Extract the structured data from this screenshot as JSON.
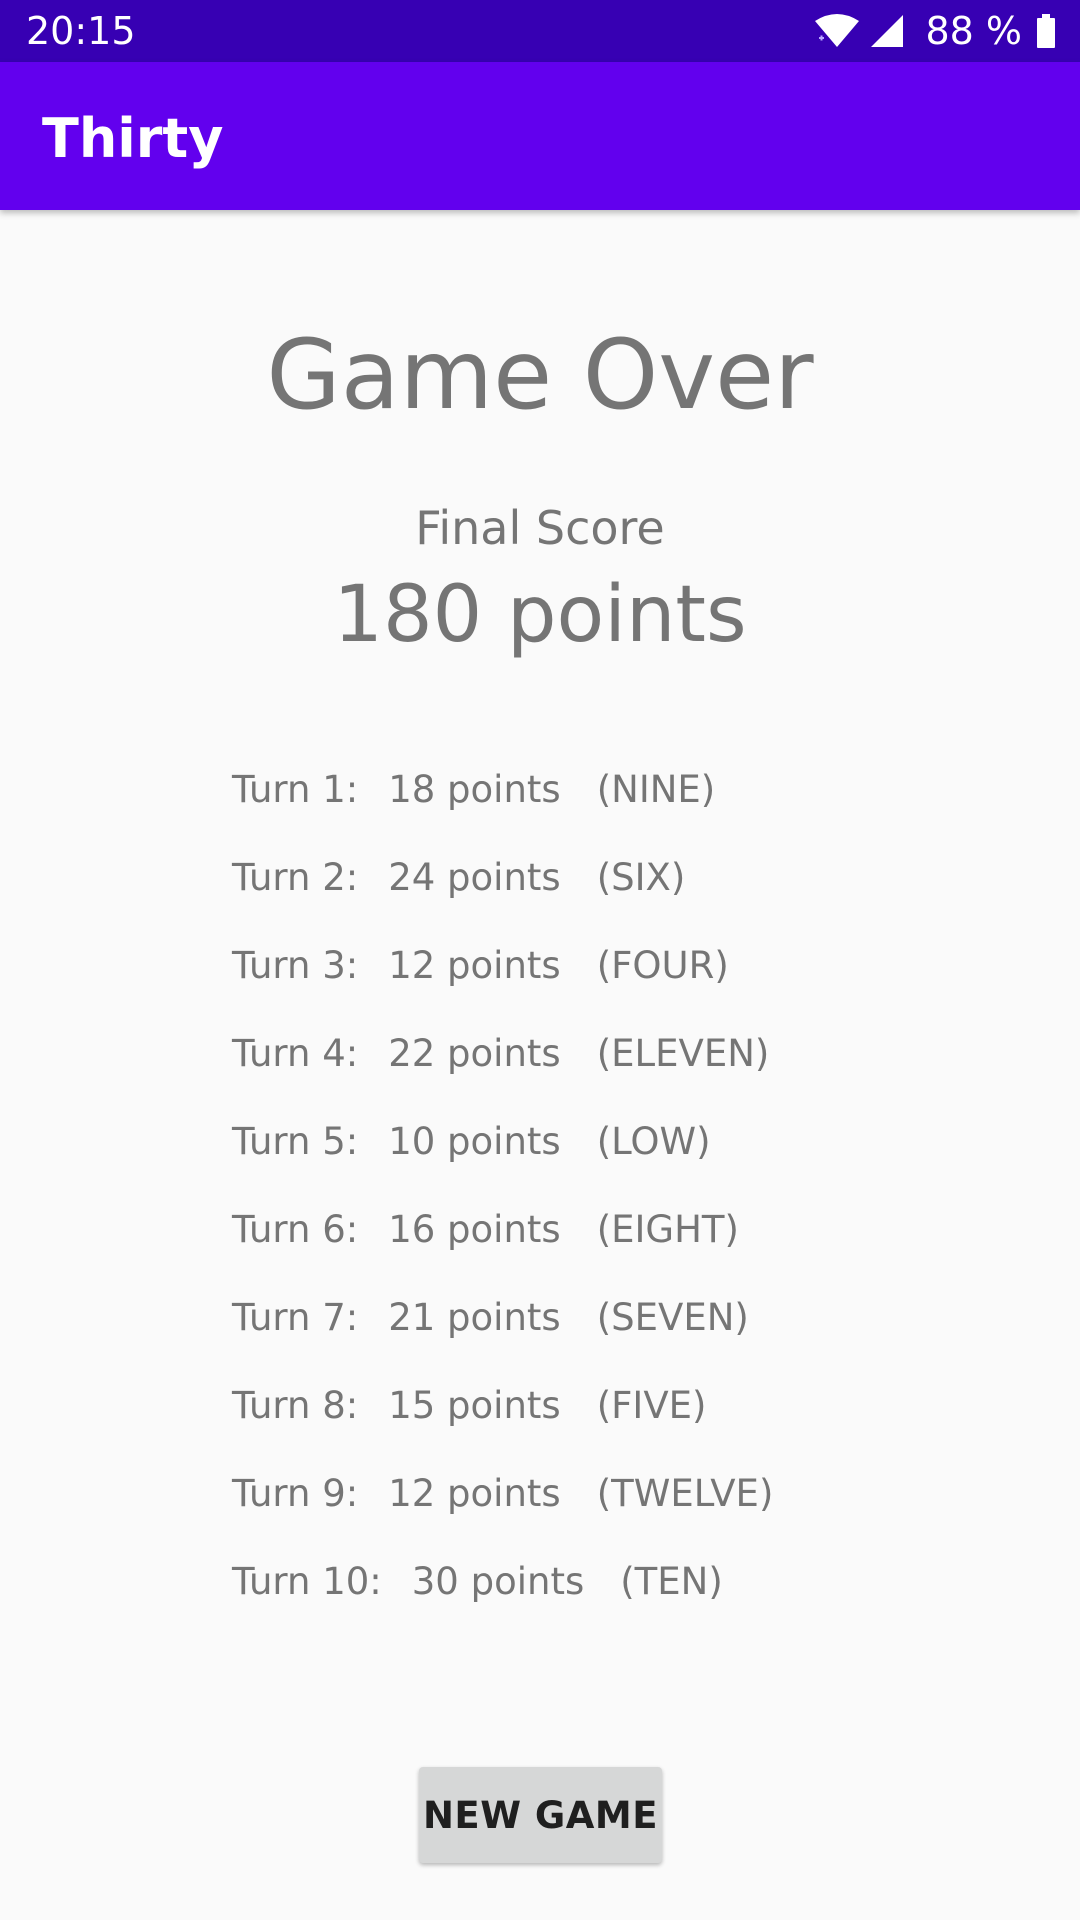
{
  "status_bar": {
    "time": "20:15",
    "battery": "88 %",
    "icons": [
      "wifi-icon",
      "signal-icon",
      "battery-icon"
    ]
  },
  "app_bar": {
    "title": "Thirty"
  },
  "main": {
    "heading": "Game Over",
    "final_score_label": "Final Score",
    "final_score_value": "180 points",
    "turns": [
      {
        "label": "Turn 1:",
        "points": "18 points",
        "choice": "(NINE)"
      },
      {
        "label": "Turn 2:",
        "points": "24 points",
        "choice": "(SIX)"
      },
      {
        "label": "Turn 3:",
        "points": "12 points",
        "choice": "(FOUR)"
      },
      {
        "label": "Turn 4:",
        "points": "22 points",
        "choice": "(ELEVEN)"
      },
      {
        "label": "Turn 5:",
        "points": "10 points",
        "choice": "(LOW)"
      },
      {
        "label": "Turn 6:",
        "points": "16 points",
        "choice": "(EIGHT)"
      },
      {
        "label": "Turn 7:",
        "points": "21 points",
        "choice": "(SEVEN)"
      },
      {
        "label": "Turn 8:",
        "points": "15 points",
        "choice": "(FIVE)"
      },
      {
        "label": "Turn 9:",
        "points": "12 points",
        "choice": "(TWELVE)"
      },
      {
        "label": "Turn 10:",
        "points": "30 points",
        "choice": "(TEN)"
      }
    ],
    "new_game_button": "NEW GAME"
  },
  "colors": {
    "status_bar": "#3700b3",
    "app_bar": "#6200ee",
    "background": "#fafafa",
    "text": "#757575",
    "button": "#d6d7d7"
  }
}
